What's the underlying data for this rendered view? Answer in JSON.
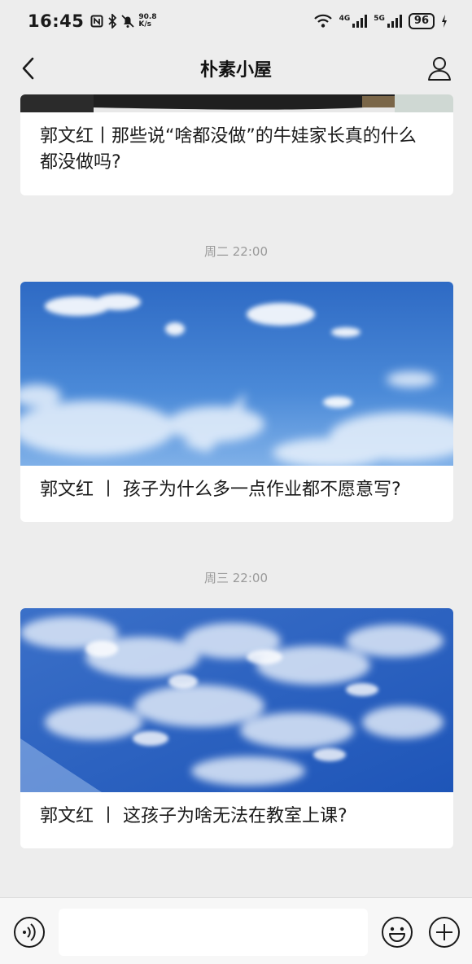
{
  "status_bar": {
    "time": "16:45",
    "net_speed_value": "90.8",
    "net_speed_unit": "K/s",
    "sim1_label": "4G",
    "sim2_label": "5G",
    "battery": "96"
  },
  "nav": {
    "title": "朴素小屋"
  },
  "messages": [
    {
      "title": "郭文红丨那些说“啥都没做”的牛娃家长真的什么都没做吗?"
    },
    {
      "timestamp": "周二 22:00",
      "title": "郭文红 丨 孩子为什么多一点作业都不愿意写?"
    },
    {
      "timestamp": "周三 22:00",
      "title": "郭文红 丨 这孩子为啥无法在教室上课?"
    }
  ],
  "colors": {
    "background": "#ededed",
    "card": "#ffffff",
    "sky_top": "#2f67c6",
    "sky_bottom": "#6e9fe0",
    "timestamp": "#9a9a9a"
  },
  "icons": {
    "back": "back-arrow-icon",
    "profile": "person-icon",
    "voice": "voice-icon",
    "emoji": "emoji-icon",
    "plus": "plus-icon"
  }
}
